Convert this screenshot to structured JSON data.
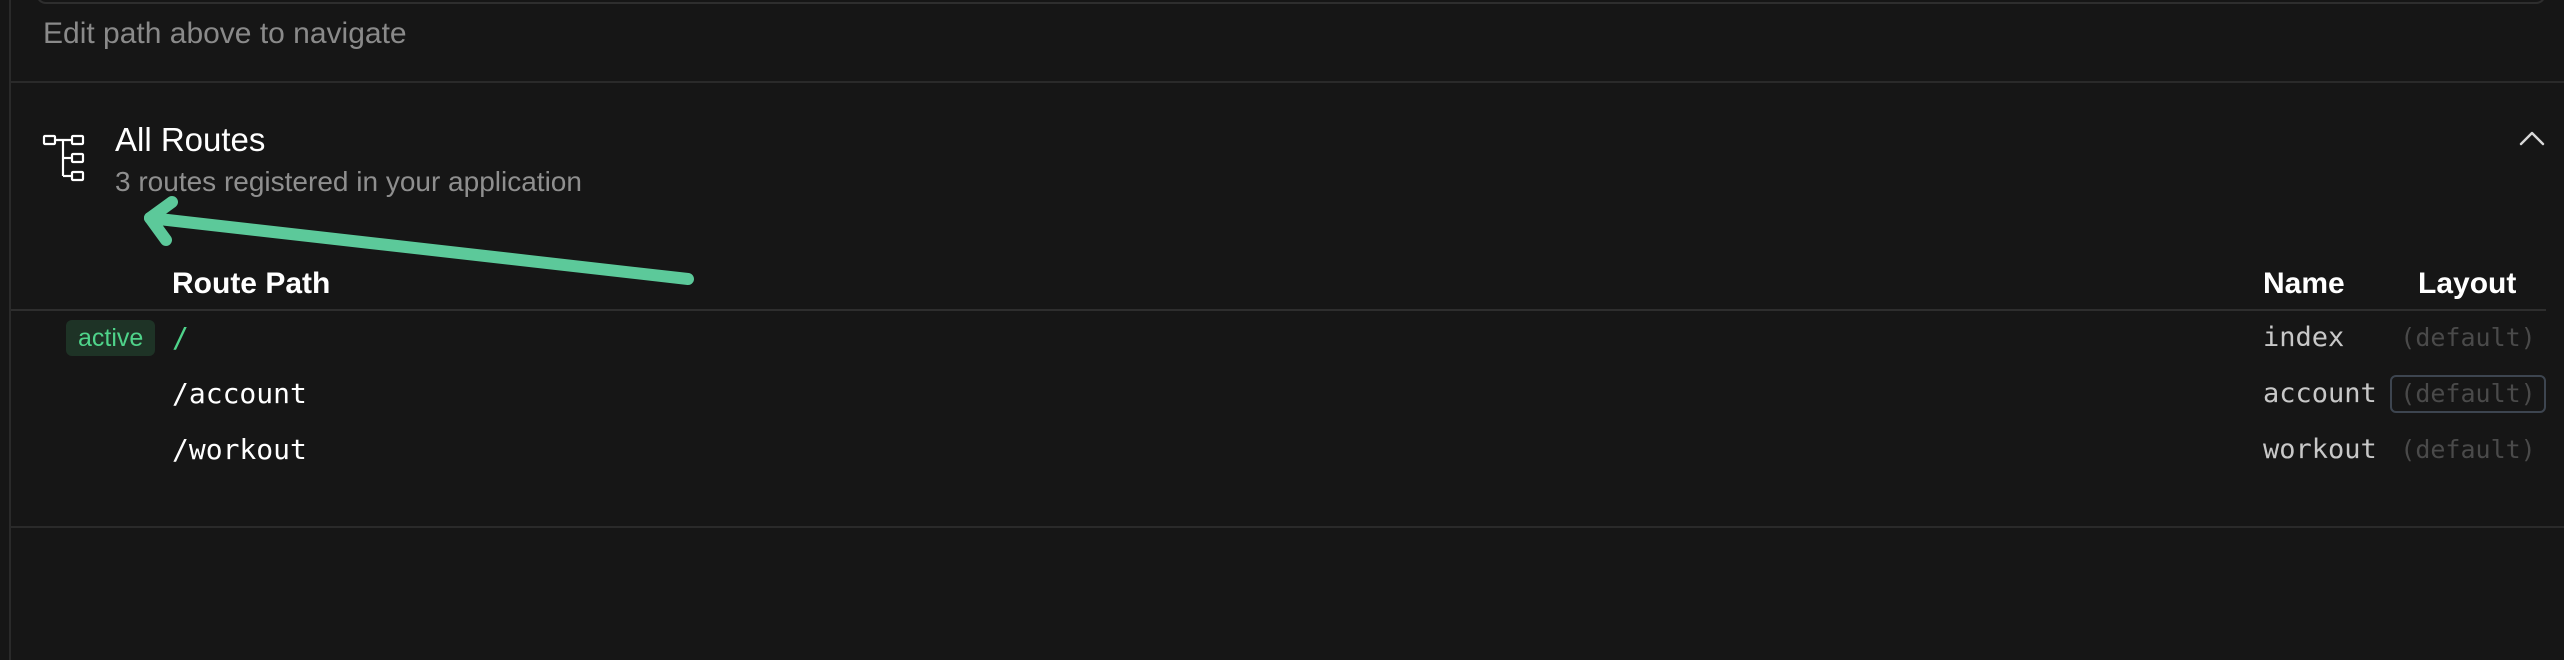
{
  "path_input": {
    "hint": "Edit path above to navigate"
  },
  "routes_section": {
    "icon": "route-tree-icon",
    "title": "All Routes",
    "subtitle": "3 routes registered in your application",
    "collapse_icon": "chevron-up-icon"
  },
  "annotation": {
    "icon": "arrow-left-icon",
    "color": "#5cc99a"
  },
  "table": {
    "columns": {
      "path": "Route Path",
      "name": "Name",
      "layout": "Layout"
    },
    "rows": [
      {
        "badge": "active",
        "path": "/",
        "name": "index",
        "layout": "(default)"
      },
      {
        "badge": "",
        "path": "/account",
        "name": "account",
        "layout": "(default)"
      },
      {
        "badge": "",
        "path": "/workout",
        "name": "workout",
        "layout": "(default)"
      }
    ]
  },
  "colors": {
    "background": "#161616",
    "active_accent": "#4fd38a",
    "muted_text": "#8f8f8f",
    "divider": "#2a2a2a"
  }
}
